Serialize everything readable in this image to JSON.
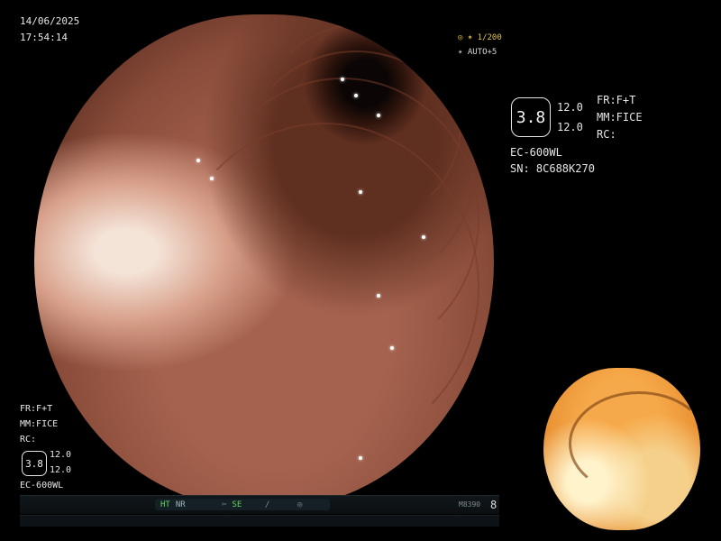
{
  "datetime": {
    "date": "14/06/2025",
    "time": "17:54:14"
  },
  "top_right": {
    "shutter_icon": "mode-icon",
    "shutter": "◎ ✶ 1/200",
    "auto_icon": "auto-icon",
    "auto": "✴ AUTO+5"
  },
  "info_right": {
    "hex_value": "3.8",
    "val1": "12.0",
    "val2": "12.0",
    "fr": "FR:F+T",
    "mm": "MM:FICE",
    "rc": "RC:",
    "model": "EC-600WL",
    "serial": "SN: 8C688K270"
  },
  "info_left": {
    "fr": "FR:F+T",
    "mm": "MM:FICE",
    "rc": "RC:",
    "hex_value": "3.8",
    "val1": "12.0",
    "val2": "12.0",
    "model": "EC-600WL"
  },
  "status_bar": {
    "ht": "HT",
    "nr": "NR",
    "se_icon": "scissors-icon",
    "se": "SE",
    "slash_icon": "slash-icon",
    "circle_icon": "record-icon",
    "code": "M8390",
    "num": "8"
  },
  "colors": {
    "accent_yellow": "#e0c34a",
    "status_green": "#64d35a"
  }
}
